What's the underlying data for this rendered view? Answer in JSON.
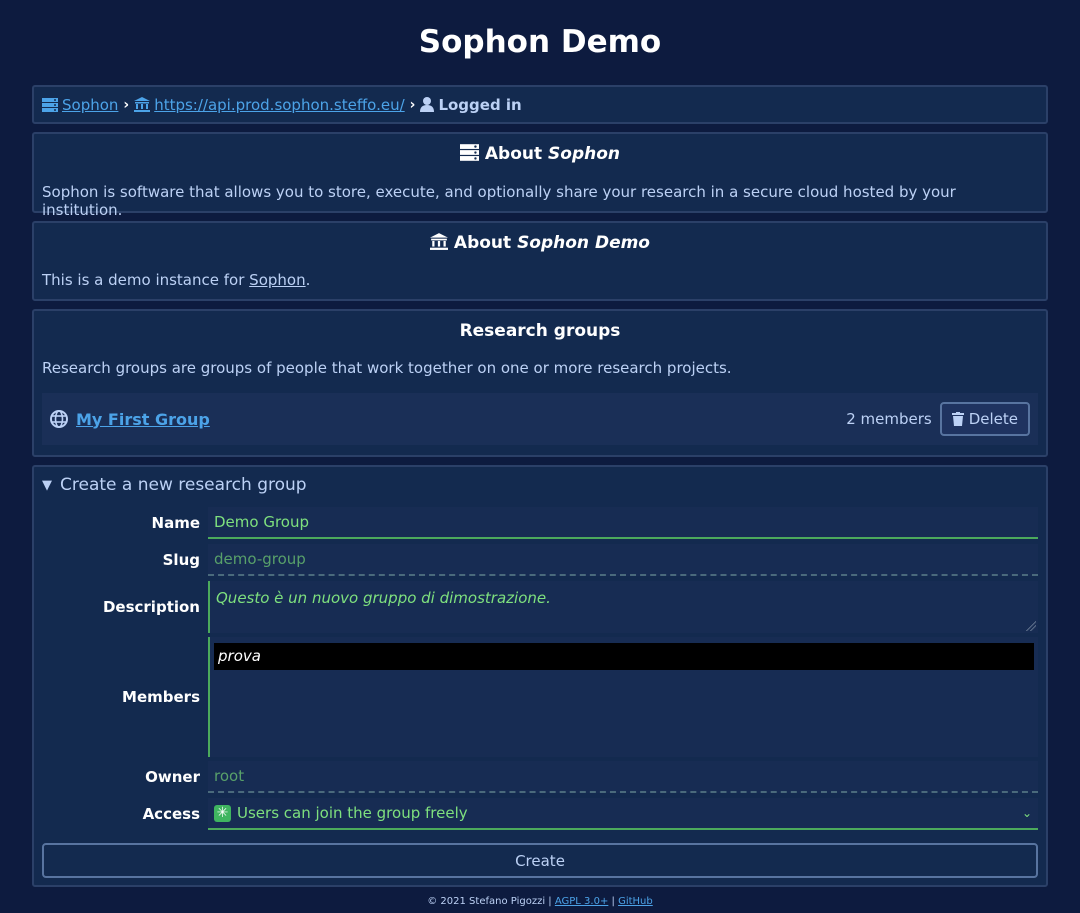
{
  "page": {
    "title": "Sophon Demo"
  },
  "breadcrumb": {
    "root_label": "Sophon",
    "instance_label": "https://api.prod.sophon.steffo.eu/",
    "current_label": "Logged in"
  },
  "about_sophon": {
    "title_prefix": "About",
    "title_name": "Sophon",
    "text": "Sophon is software that allows you to store, execute, and optionally share your research in a secure cloud hosted by your institution."
  },
  "about_instance": {
    "title_prefix": "About",
    "title_name": "Sophon Demo",
    "text_prefix": "This is a demo instance for",
    "link": "Sophon",
    "text_suffix": "."
  },
  "research_groups": {
    "title": "Research groups",
    "text": "Research groups are groups of people that work together on one or more research projects.",
    "groups": [
      {
        "name": "My First Group",
        "members": "2 members",
        "delete_label": "Delete"
      }
    ]
  },
  "create_form": {
    "summary": "Create a new research group",
    "name_label": "Name",
    "name_value": "Demo Group",
    "slug_label": "Slug",
    "slug_value": "demo-group",
    "description_label": "Description",
    "description_value": "Questo è un nuovo gruppo di dimostrazione.",
    "members_label": "Members",
    "members_options": [
      "prova"
    ],
    "owner_label": "Owner",
    "owner_value": "root",
    "access_label": "Access",
    "access_value": "Users can join the group freely",
    "create_label": "Create"
  },
  "footer": {
    "copyright": "© 2021 Stefano Pigozzi",
    "license": "AGPL 3.0+",
    "sep": "|",
    "github": "GitHub"
  },
  "colors": {
    "background": "#0d1b3f",
    "panel": "#132a4f",
    "link": "#4ca3e8",
    "valid": "#7ee07e"
  }
}
